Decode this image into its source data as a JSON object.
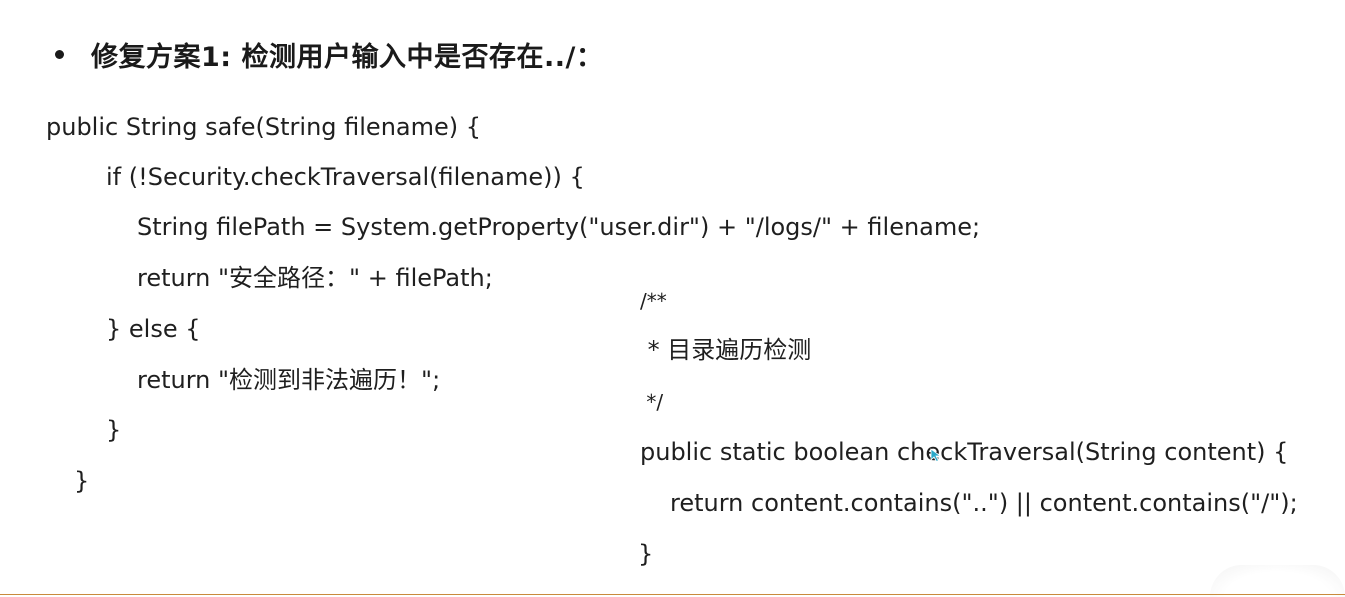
{
  "heading": {
    "text": "修复方案1: 检测用户输入中是否存在../："
  },
  "left_code": [
    "public String safe(String filename) {",
    "if (!Security.checkTraversal(filename)) {",
    "String filePath = System.getProperty(\"user.dir\") + \"/logs/\" + filename;",
    "return \"安全路径：\" + filePath;",
    "} else {",
    "return \"检测到非法遍历！\";",
    "}",
    "}"
  ],
  "right_code": [
    "/**",
    " * 目录遍历检测",
    " */",
    "public static boolean checkTraversal(String content) {",
    "return content.contains(\"..\") || content.contains(\"/\");",
    "}"
  ],
  "colors": {
    "text": "#1f1f1f",
    "accent_rule": "#c98a3c",
    "cursor": "#2aa9c9"
  }
}
